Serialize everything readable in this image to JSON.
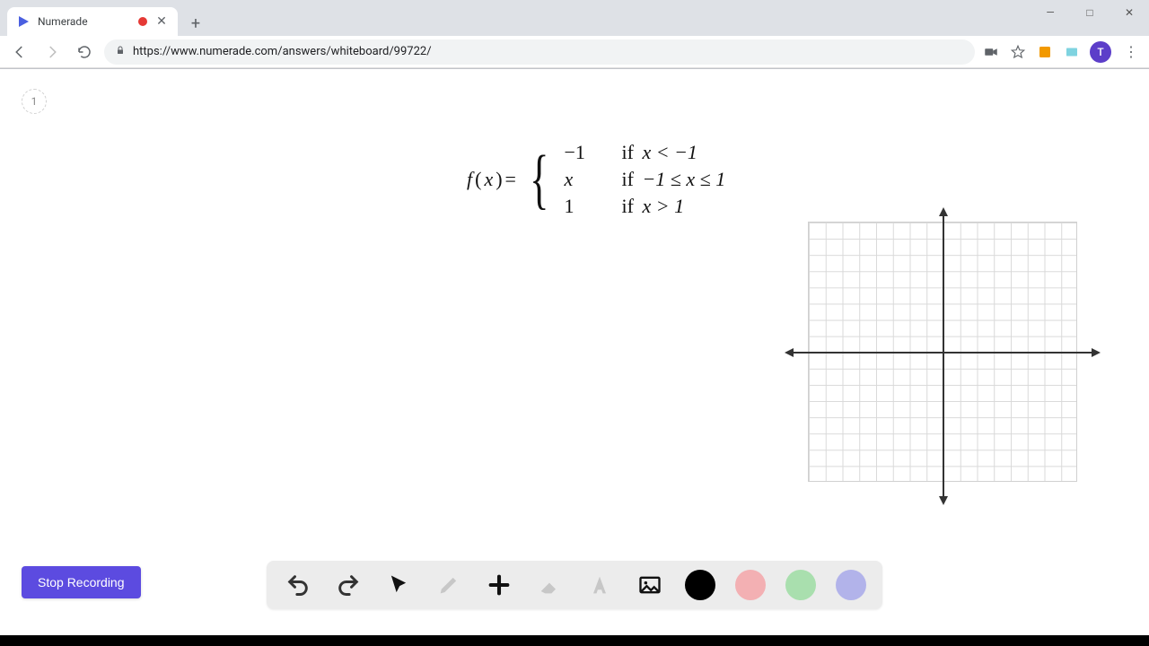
{
  "window": {
    "minimize": "—",
    "maximize": "□",
    "close": "✕"
  },
  "tab": {
    "title": "Numerade",
    "close": "✕"
  },
  "toolbar": {
    "url": "https://www.numerade.com/answers/whiteboard/99722/",
    "avatar_initial": "T"
  },
  "page": {
    "badge": "1"
  },
  "formula": {
    "lhs_f": "f",
    "lhs_open": "(",
    "lhs_x": "x",
    "lhs_close": ")",
    "eq": " = ",
    "cases": [
      {
        "value": "−1",
        "cond_if": "if",
        "cond_expr": "x < −1"
      },
      {
        "value": "x",
        "cond_if": "if",
        "cond_expr": "−1 ≤ x ≤ 1"
      },
      {
        "value": "1",
        "cond_if": "if",
        "cond_expr": "x > 1"
      }
    ]
  },
  "tools": {
    "undo": "undo",
    "redo": "redo",
    "pointer": "pointer",
    "pencil": "pencil",
    "add": "add",
    "eraser": "eraser",
    "text": "text",
    "image": "image"
  },
  "colors": {
    "black": "#000000",
    "red": "#f3b0b3",
    "green": "#a9dfae",
    "purple": "#b2b3ea"
  },
  "buttons": {
    "stop_recording": "Stop Recording"
  }
}
